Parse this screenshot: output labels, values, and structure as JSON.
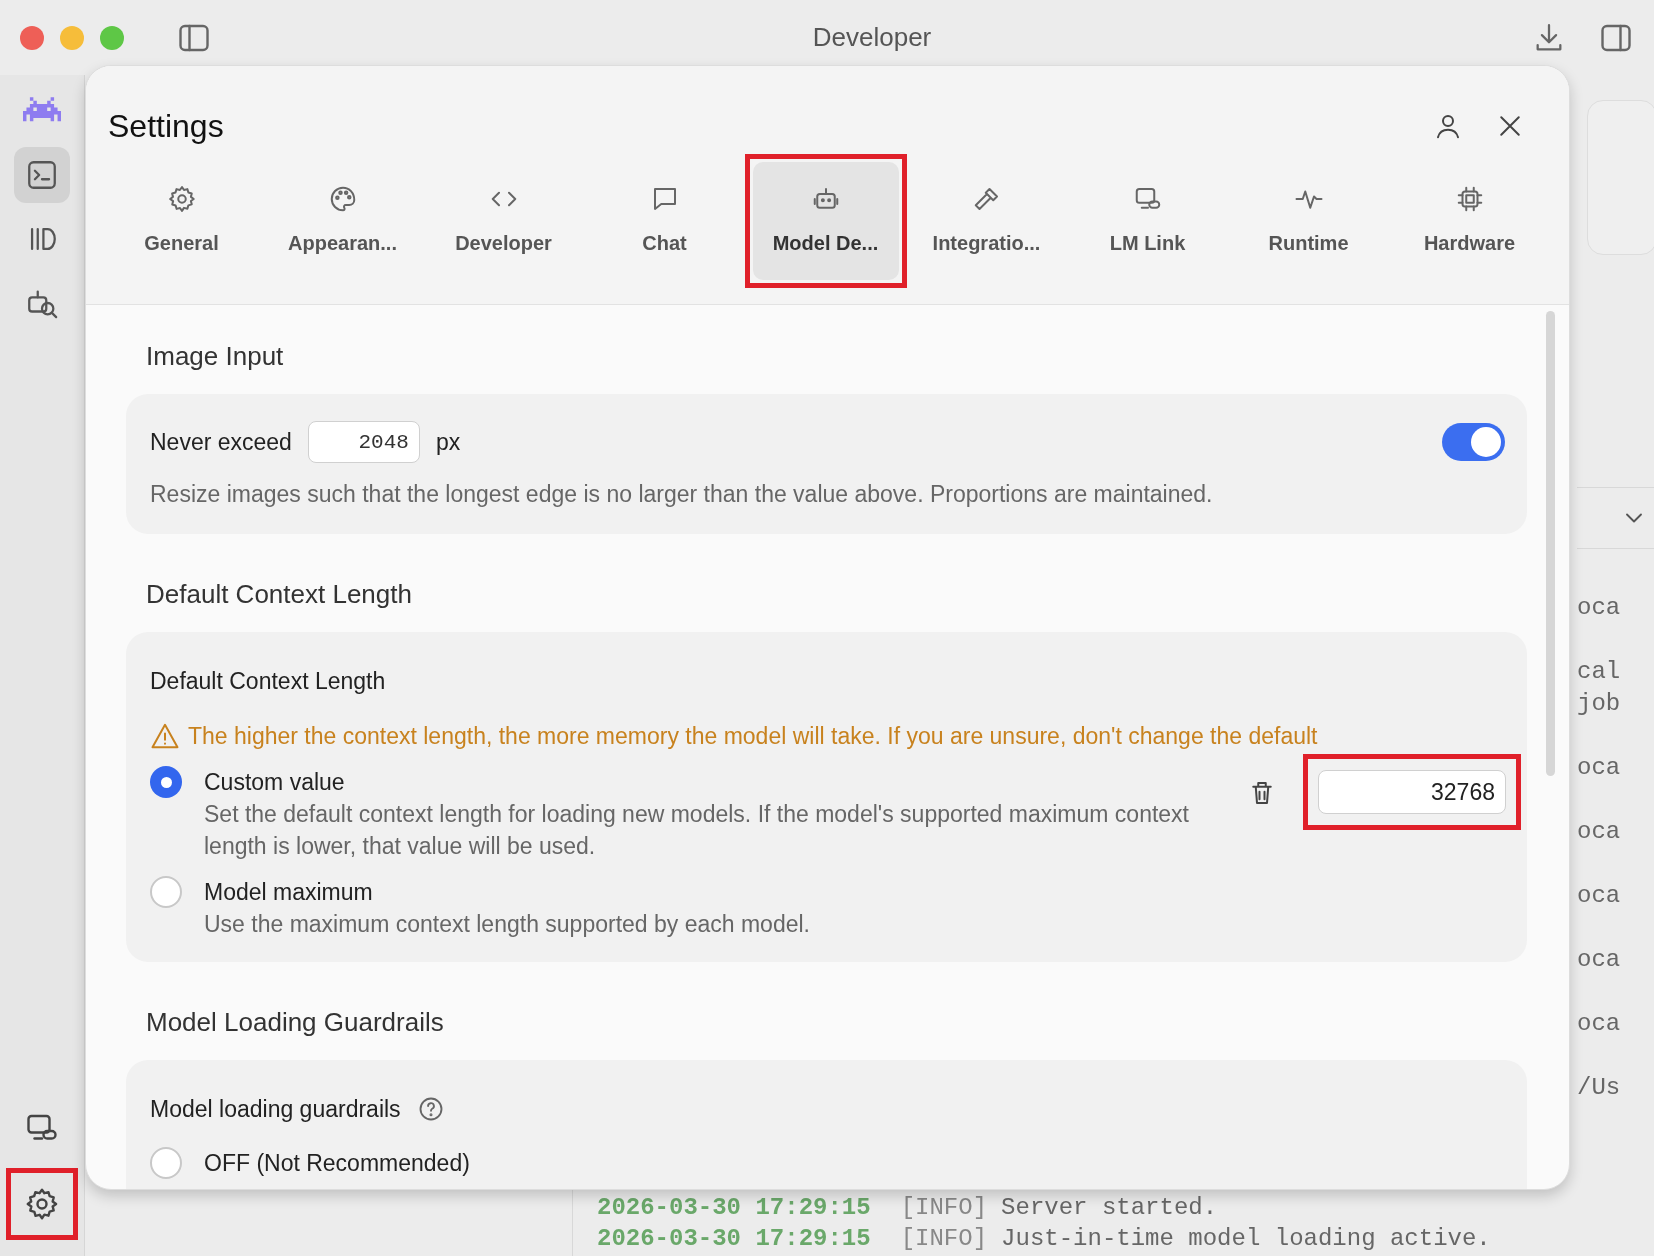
{
  "window": {
    "title": "Developer"
  },
  "sidebar": {
    "top_items": [
      {
        "selected": false
      },
      {
        "selected": true
      },
      {
        "selected": false
      },
      {
        "selected": false
      }
    ],
    "bottom_items": [
      {
        "selected": false,
        "highlighted": false
      },
      {
        "selected": false,
        "highlighted": true
      }
    ]
  },
  "background": {
    "log_fragments": [
      [
        "oca"
      ],
      [
        "cal",
        "job"
      ],
      [
        "oca"
      ],
      [
        "oca"
      ],
      [
        "oca"
      ],
      [
        "oca"
      ],
      [
        "oca"
      ],
      [
        "/Us"
      ]
    ],
    "log_lines": [
      {
        "time": "2026-03-30 17:29:15",
        "level": "[INFO]",
        "message": "Server started."
      },
      {
        "time": "2026-03-30 17:29:15",
        "level": "[INFO]",
        "message": "Just-in-time model loading active."
      }
    ]
  },
  "settings": {
    "title": "Settings",
    "tabs": [
      {
        "label": "General",
        "selected": false,
        "highlighted": false
      },
      {
        "label": "Appearan...",
        "selected": false,
        "highlighted": false
      },
      {
        "label": "Developer",
        "selected": false,
        "highlighted": false
      },
      {
        "label": "Chat",
        "selected": false,
        "highlighted": false
      },
      {
        "label": "Model De...",
        "selected": true,
        "highlighted": true
      },
      {
        "label": "Integratio...",
        "selected": false,
        "highlighted": false
      },
      {
        "label": "LM Link",
        "selected": false,
        "highlighted": false
      },
      {
        "label": "Runtime",
        "selected": false,
        "highlighted": false
      },
      {
        "label": "Hardware",
        "selected": false,
        "highlighted": false
      }
    ],
    "image_input": {
      "heading": "Image Input",
      "label": "Never exceed",
      "value": "2048",
      "unit": "px",
      "on": true,
      "description": "Resize images such that the longest edge is no larger than the value above. Proportions are maintained."
    },
    "context_length": {
      "heading": "Default Context Length",
      "subtitle": "Default Context Length",
      "warning": "The higher the context length, the more memory the model will take. If you are unsure, don't change the default",
      "options": [
        {
          "label": "Custom value",
          "description": "Set the default context length for loading new models. If the model's supported maximum context length is lower, that value will be used.",
          "selected": true
        },
        {
          "label": "Model maximum",
          "description": "Use the maximum context length supported by each model.",
          "selected": false
        }
      ],
      "custom_value": "32768",
      "custom_value_highlighted": true
    },
    "guardrails": {
      "heading": "Model Loading Guardrails",
      "subtitle": "Model loading guardrails",
      "options": [
        {
          "label": "OFF (Not Recommended)",
          "selected": false
        }
      ]
    }
  }
}
